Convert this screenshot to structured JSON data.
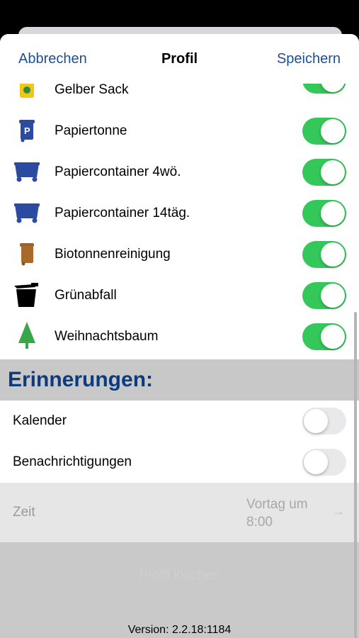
{
  "navbar": {
    "cancel_label": "Abbrechen",
    "title": "Profil",
    "save_label": "Speichern"
  },
  "waste_types": [
    {
      "label": "Gelber Sack",
      "icon": "yellow-bag-icon",
      "enabled": true
    },
    {
      "label": "Papiertonne",
      "icon": "paper-bin-icon",
      "enabled": true
    },
    {
      "label": "Papiercontainer 4wö.",
      "icon": "paper-container-icon",
      "enabled": true
    },
    {
      "label": "Papiercontainer 14täg.",
      "icon": "paper-container-icon",
      "enabled": true
    },
    {
      "label": "Biotonnenreinigung",
      "icon": "bio-bin-icon",
      "enabled": true
    },
    {
      "label": "Grünabfall",
      "icon": "green-waste-icon",
      "enabled": true
    },
    {
      "label": "Weihnachtsbaum",
      "icon": "christmas-tree-icon",
      "enabled": true
    }
  ],
  "reminders": {
    "header": "Erinnerungen:",
    "calendar_label": "Kalender",
    "calendar_enabled": false,
    "notifications_label": "Benachrichtigungen",
    "notifications_enabled": false,
    "time_label": "Zeit",
    "time_value_line1": "Vortag um",
    "time_value_line2": "8:00"
  },
  "delete_label": "Profil löschen",
  "version": "Version: 2.2.18:1184",
  "colors": {
    "accent": "#1d4f91",
    "toggle_on": "#34c759",
    "section_title": "#0c3c7d"
  }
}
